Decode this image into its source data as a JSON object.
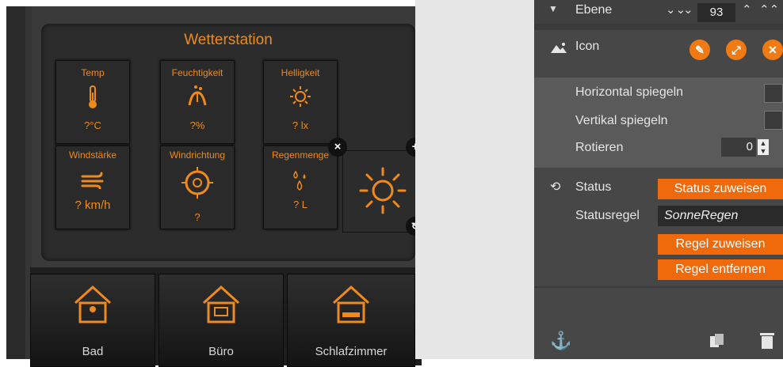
{
  "widget": {
    "title": "Wetterstation",
    "tiles": [
      {
        "label": "Temp",
        "value": "?°C",
        "icon": "thermometer-icon"
      },
      {
        "label": "Feuchtigkeit",
        "value": "?%",
        "icon": "humidity-icon"
      },
      {
        "label": "Helligkeit",
        "value": "? lx",
        "icon": "brightness-icon"
      },
      {
        "label": "Windstärke",
        "value": "? km/h",
        "icon": "wind-icon"
      },
      {
        "label": "Windrichtung",
        "value": "?",
        "icon": "compass-icon"
      },
      {
        "label": "Regenmenge",
        "value": "? L",
        "icon": "rain-icon"
      }
    ],
    "selected_icon": "sun-icon",
    "handle_close": "×",
    "handle_add": "+"
  },
  "rooms": [
    {
      "label": "Bad",
      "icon": "bath-house-icon"
    },
    {
      "label": "Büro",
      "icon": "office-house-icon"
    },
    {
      "label": "Schlafzimmer",
      "icon": "bed-house-icon"
    }
  ],
  "panel": {
    "layer_label": "Ebene",
    "layer_value": "93",
    "icon_section": "Icon",
    "flip_h": "Horizontal spiegeln",
    "flip_v": "Vertikal spiegeln",
    "rotate": "Rotieren",
    "rotate_value": "0",
    "status_section": "Status",
    "status_assign": "Status zuweisen",
    "status_rule_label": "Statusregel",
    "status_rule_value": "SonneRegen",
    "rule_assign": "Regel zuweisen",
    "rule_remove": "Regel entfernen"
  },
  "colors": {
    "accent": "#f08a1c",
    "button": "#f06a0c"
  }
}
